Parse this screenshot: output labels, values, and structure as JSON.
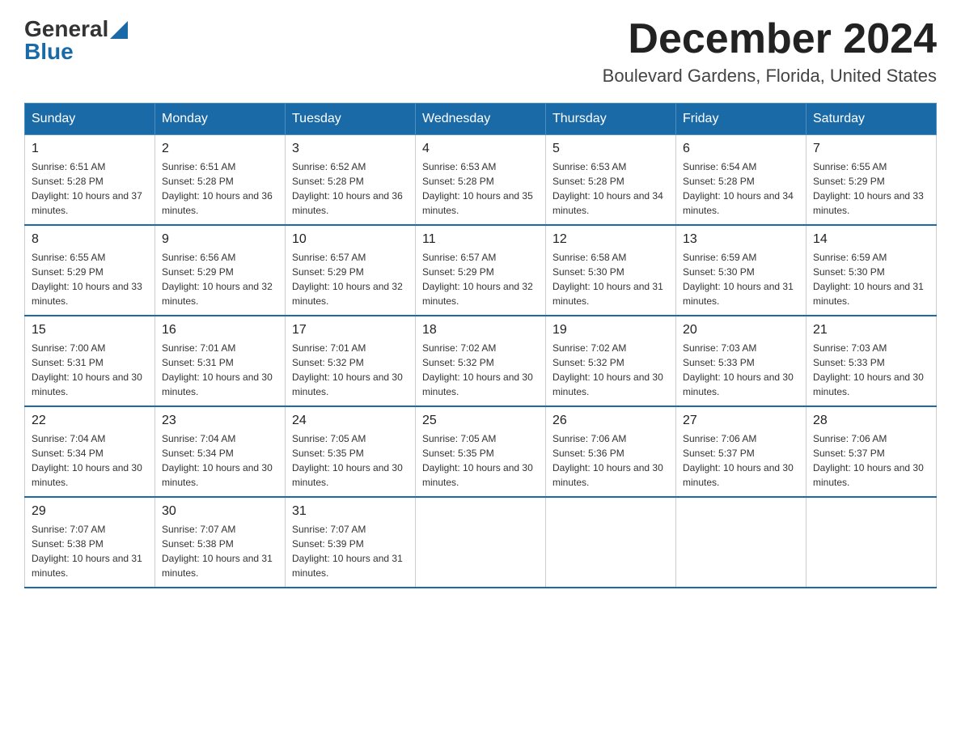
{
  "logo": {
    "general": "General",
    "blue": "Blue"
  },
  "header": {
    "month": "December 2024",
    "location": "Boulevard Gardens, Florida, United States"
  },
  "weekdays": [
    "Sunday",
    "Monday",
    "Tuesday",
    "Wednesday",
    "Thursday",
    "Friday",
    "Saturday"
  ],
  "weeks": [
    [
      {
        "day": "1",
        "sunrise": "6:51 AM",
        "sunset": "5:28 PM",
        "daylight": "10 hours and 37 minutes."
      },
      {
        "day": "2",
        "sunrise": "6:51 AM",
        "sunset": "5:28 PM",
        "daylight": "10 hours and 36 minutes."
      },
      {
        "day": "3",
        "sunrise": "6:52 AM",
        "sunset": "5:28 PM",
        "daylight": "10 hours and 36 minutes."
      },
      {
        "day": "4",
        "sunrise": "6:53 AM",
        "sunset": "5:28 PM",
        "daylight": "10 hours and 35 minutes."
      },
      {
        "day": "5",
        "sunrise": "6:53 AM",
        "sunset": "5:28 PM",
        "daylight": "10 hours and 34 minutes."
      },
      {
        "day": "6",
        "sunrise": "6:54 AM",
        "sunset": "5:28 PM",
        "daylight": "10 hours and 34 minutes."
      },
      {
        "day": "7",
        "sunrise": "6:55 AM",
        "sunset": "5:29 PM",
        "daylight": "10 hours and 33 minutes."
      }
    ],
    [
      {
        "day": "8",
        "sunrise": "6:55 AM",
        "sunset": "5:29 PM",
        "daylight": "10 hours and 33 minutes."
      },
      {
        "day": "9",
        "sunrise": "6:56 AM",
        "sunset": "5:29 PM",
        "daylight": "10 hours and 32 minutes."
      },
      {
        "day": "10",
        "sunrise": "6:57 AM",
        "sunset": "5:29 PM",
        "daylight": "10 hours and 32 minutes."
      },
      {
        "day": "11",
        "sunrise": "6:57 AM",
        "sunset": "5:29 PM",
        "daylight": "10 hours and 32 minutes."
      },
      {
        "day": "12",
        "sunrise": "6:58 AM",
        "sunset": "5:30 PM",
        "daylight": "10 hours and 31 minutes."
      },
      {
        "day": "13",
        "sunrise": "6:59 AM",
        "sunset": "5:30 PM",
        "daylight": "10 hours and 31 minutes."
      },
      {
        "day": "14",
        "sunrise": "6:59 AM",
        "sunset": "5:30 PM",
        "daylight": "10 hours and 31 minutes."
      }
    ],
    [
      {
        "day": "15",
        "sunrise": "7:00 AM",
        "sunset": "5:31 PM",
        "daylight": "10 hours and 30 minutes."
      },
      {
        "day": "16",
        "sunrise": "7:01 AM",
        "sunset": "5:31 PM",
        "daylight": "10 hours and 30 minutes."
      },
      {
        "day": "17",
        "sunrise": "7:01 AM",
        "sunset": "5:32 PM",
        "daylight": "10 hours and 30 minutes."
      },
      {
        "day": "18",
        "sunrise": "7:02 AM",
        "sunset": "5:32 PM",
        "daylight": "10 hours and 30 minutes."
      },
      {
        "day": "19",
        "sunrise": "7:02 AM",
        "sunset": "5:32 PM",
        "daylight": "10 hours and 30 minutes."
      },
      {
        "day": "20",
        "sunrise": "7:03 AM",
        "sunset": "5:33 PM",
        "daylight": "10 hours and 30 minutes."
      },
      {
        "day": "21",
        "sunrise": "7:03 AM",
        "sunset": "5:33 PM",
        "daylight": "10 hours and 30 minutes."
      }
    ],
    [
      {
        "day": "22",
        "sunrise": "7:04 AM",
        "sunset": "5:34 PM",
        "daylight": "10 hours and 30 minutes."
      },
      {
        "day": "23",
        "sunrise": "7:04 AM",
        "sunset": "5:34 PM",
        "daylight": "10 hours and 30 minutes."
      },
      {
        "day": "24",
        "sunrise": "7:05 AM",
        "sunset": "5:35 PM",
        "daylight": "10 hours and 30 minutes."
      },
      {
        "day": "25",
        "sunrise": "7:05 AM",
        "sunset": "5:35 PM",
        "daylight": "10 hours and 30 minutes."
      },
      {
        "day": "26",
        "sunrise": "7:06 AM",
        "sunset": "5:36 PM",
        "daylight": "10 hours and 30 minutes."
      },
      {
        "day": "27",
        "sunrise": "7:06 AM",
        "sunset": "5:37 PM",
        "daylight": "10 hours and 30 minutes."
      },
      {
        "day": "28",
        "sunrise": "7:06 AM",
        "sunset": "5:37 PM",
        "daylight": "10 hours and 30 minutes."
      }
    ],
    [
      {
        "day": "29",
        "sunrise": "7:07 AM",
        "sunset": "5:38 PM",
        "daylight": "10 hours and 31 minutes."
      },
      {
        "day": "30",
        "sunrise": "7:07 AM",
        "sunset": "5:38 PM",
        "daylight": "10 hours and 31 minutes."
      },
      {
        "day": "31",
        "sunrise": "7:07 AM",
        "sunset": "5:39 PM",
        "daylight": "10 hours and 31 minutes."
      },
      null,
      null,
      null,
      null
    ]
  ],
  "labels": {
    "sunrise": "Sunrise:",
    "sunset": "Sunset:",
    "daylight": "Daylight:"
  }
}
